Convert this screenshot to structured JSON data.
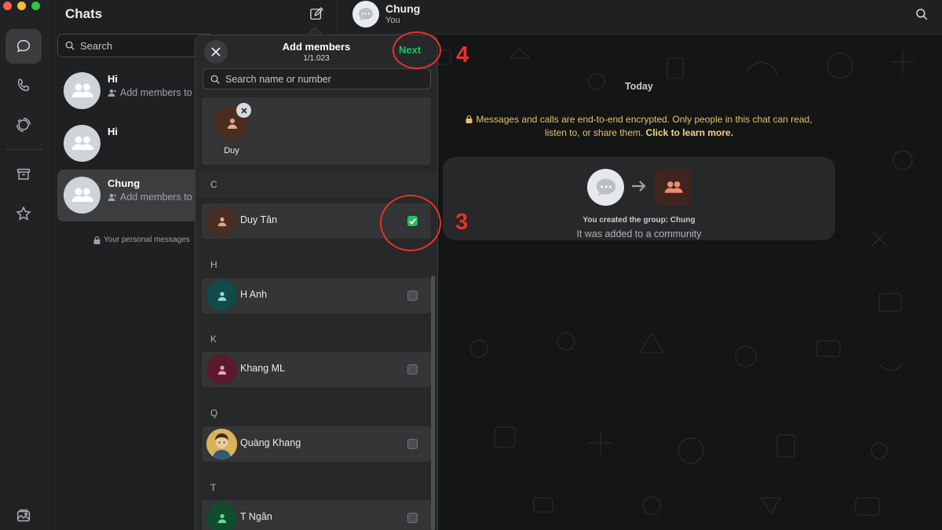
{
  "rail": {
    "traffic_colors": [
      "#fe5f57",
      "#febc2e",
      "#28c840"
    ],
    "items": [
      {
        "icon": "chats-icon",
        "active": true
      },
      {
        "icon": "phone-icon",
        "active": false
      },
      {
        "icon": "status-icon",
        "active": false
      },
      {
        "icon": "archive-icon",
        "active": false
      },
      {
        "icon": "star-icon",
        "active": false
      },
      {
        "icon": "media-icon",
        "active": false
      }
    ]
  },
  "chats": {
    "title": "Chats",
    "search_placeholder": "Search",
    "items": [
      {
        "name": "Hi",
        "sub": "Add members to"
      },
      {
        "name": "Hi",
        "sub": ""
      },
      {
        "name": "Chung",
        "sub": "Add members to"
      }
    ],
    "personal_note": "Your personal messages"
  },
  "conversation": {
    "title": "Chung",
    "subtitle": "You",
    "date": "Today",
    "encryption_text": "Messages and calls are end-to-end encrypted. Only people in this chat can read, listen to, or share them.",
    "encryption_link": "Click to learn more.",
    "system_line1": "You created the group: Chung",
    "system_line2": "It was added to a community"
  },
  "add_members": {
    "title": "Add members",
    "count": "1/1.023",
    "next_label": "Next",
    "search_placeholder": "Search name or number",
    "selected": [
      {
        "name": "Duy"
      }
    ],
    "sections": [
      {
        "letter": "C",
        "contacts": [
          {
            "name": "Duy Tân",
            "checked": true,
            "avatar_color": "#4a2d22",
            "figure_color": "#e0a68c"
          }
        ]
      },
      {
        "letter": "H",
        "contacts": [
          {
            "name": "H Anh",
            "checked": false,
            "avatar_color": "#114a49",
            "figure_color": "#8fe0d6"
          }
        ]
      },
      {
        "letter": "K",
        "contacts": [
          {
            "name": "Khang ML",
            "checked": false,
            "avatar_color": "#5b1a2c",
            "figure_color": "#f09fb4"
          }
        ]
      },
      {
        "letter": "Q",
        "contacts": [
          {
            "name": "Quàng Khang",
            "checked": false,
            "avatar_color": "#d9b35a",
            "figure_color": "#3b2b1a"
          }
        ]
      },
      {
        "letter": "T",
        "contacts": [
          {
            "name": "T Ngân",
            "checked": false,
            "avatar_color": "#0f4d2c",
            "figure_color": "#5fe08f"
          }
        ]
      }
    ]
  },
  "annotations": [
    {
      "label": "4"
    },
    {
      "label": "3"
    }
  ],
  "colors": {
    "accent_green": "#21c063",
    "annotation_red": "#e8312b",
    "encryption_yellow": "#e3c26b"
  }
}
